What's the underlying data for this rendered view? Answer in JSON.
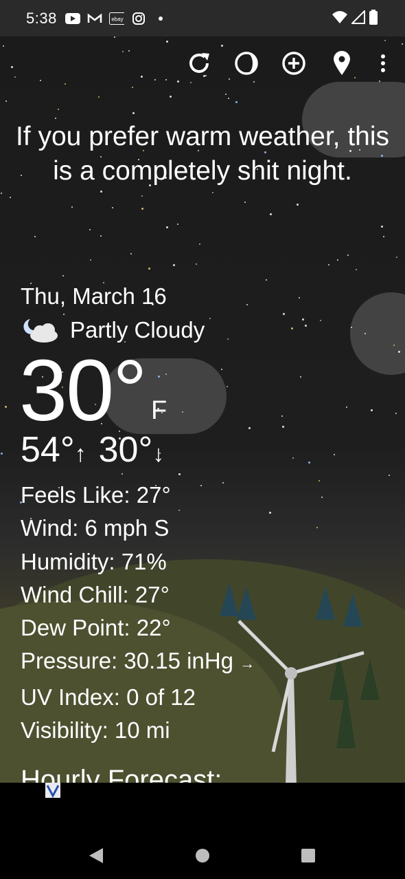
{
  "status_bar": {
    "time": "5:38",
    "notif_icons": [
      "youtube-icon",
      "gmail-icon",
      "ebay-icon",
      "instagram-icon",
      "dot-icon"
    ],
    "ebay_label": "ebay",
    "sys_icons": [
      "wifi-icon",
      "signal-icon",
      "battery-icon"
    ]
  },
  "toolbar": {
    "icons": [
      "refresh-icon",
      "moon-phase-icon",
      "add-location-icon",
      "location-pin-icon",
      "more-options-icon"
    ]
  },
  "quote": "If you prefer warm weather, this is a completely shit night.",
  "weather": {
    "date": "Thu, March 16",
    "condition": "Partly Cloudy",
    "condition_icon": "partly-cloudy-night-icon",
    "temperature": "30°",
    "unit": "F",
    "high": "54°",
    "high_arrow": "↑",
    "low": "30°",
    "low_arrow": "↓"
  },
  "details": {
    "feels_like": "Feels Like:  27°",
    "wind": "Wind:  6 mph S",
    "humidity": "Humidity:  71%",
    "wind_chill": "Wind Chill:  27°",
    "dew_point": "Dew Point:  22°",
    "pressure": "Pressure:  30.15 inHg",
    "pressure_trend": "→",
    "uv_index": "UV Index:  0 of 12",
    "visibility": "Visibility:  10 mi"
  },
  "hourly_heading": "Hourly Forecast:",
  "nav": {
    "icons": [
      "back-icon",
      "home-icon",
      "recents-icon"
    ]
  }
}
